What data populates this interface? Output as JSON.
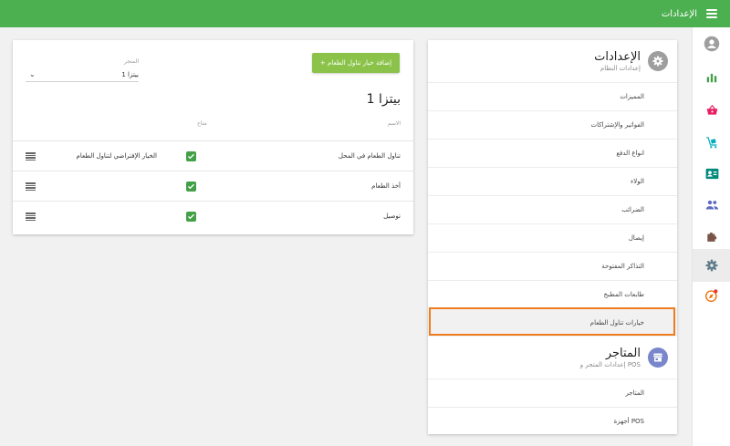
{
  "header": {
    "title": "الإعدادات",
    "menu_icon": "hamburger-icon"
  },
  "rail": {
    "items": [
      {
        "name": "account",
        "icon": "account-circle-icon",
        "color": "#9e9e9e"
      },
      {
        "name": "reports",
        "icon": "bar-chart-icon",
        "color": "#43a047"
      },
      {
        "name": "sales",
        "icon": "basket-icon",
        "color": "#e91e63"
      },
      {
        "name": "delivery",
        "icon": "cart-delivery-icon",
        "color": "#00acc1"
      },
      {
        "name": "customers",
        "icon": "contact-card-icon",
        "color": "#00897b"
      },
      {
        "name": "users",
        "icon": "people-icon",
        "color": "#5c6bc0"
      },
      {
        "name": "addons",
        "icon": "puzzle-icon",
        "color": "#795548"
      },
      {
        "name": "settings",
        "icon": "gear-icon",
        "color": "#607d8b",
        "active": true
      },
      {
        "name": "support",
        "icon": "compass-icon",
        "color": "#ef6c00"
      }
    ]
  },
  "settings_panel": {
    "system": {
      "title": "الإعدادات",
      "subtitle": "إعدادات النظام"
    },
    "menu": [
      "المميزات",
      "الفواتير والإشتراكات",
      "انواع الدفع",
      "الولاء",
      "الضرائب",
      "إيصال",
      "التذاكر المفتوحة",
      "طابعات المطبخ",
      "خيارات تناول الطعام"
    ],
    "selected_index": 8,
    "stores": {
      "title": "المتاجر",
      "subtitle": "إعدادات المتجر و POS"
    },
    "stores_menu": [
      "المتاجر",
      "أجهزة POS"
    ]
  },
  "dining_panel": {
    "add_button": "+ إضافة خيار تناول الطعام",
    "store_label": "المتجر",
    "store_value": "بيتزا 1",
    "title": "بيتزا 1",
    "col_name": "الاسم",
    "col_available": "متاح",
    "rows": [
      {
        "name": "تناول الطعام في المحل",
        "available": true,
        "default_label": "الخيار الإفتراضي لتناول الطعام"
      },
      {
        "name": "أخذ الطعام",
        "available": true,
        "default_label": ""
      },
      {
        "name": "توصيل",
        "available": true,
        "default_label": ""
      }
    ]
  }
}
